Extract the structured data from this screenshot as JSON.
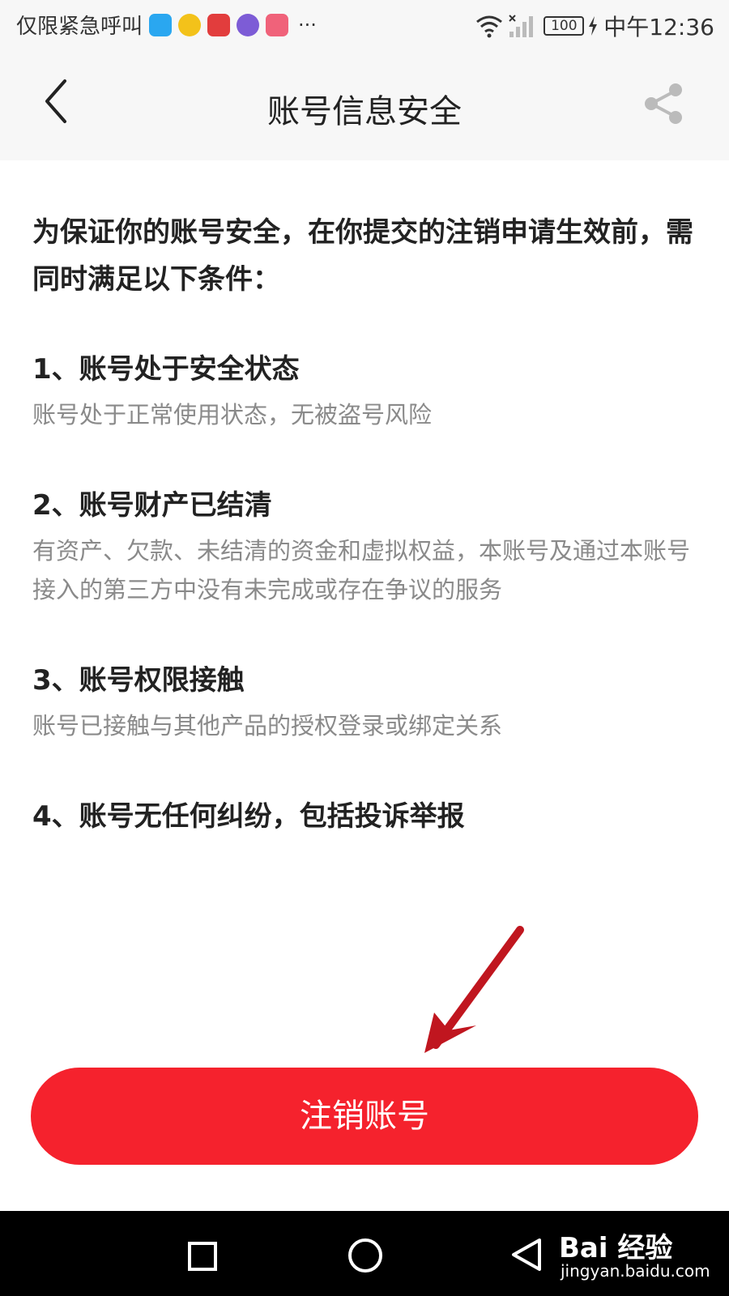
{
  "status_bar": {
    "carrier_text": "仅限紧急呼叫",
    "app_icon_colors": [
      "#2aa7f0",
      "#f3c21a",
      "#e23d3d",
      "#7d5cd6",
      "#f0627a"
    ],
    "dots": "···",
    "battery": "100",
    "time": "中午12:36"
  },
  "header": {
    "title": "账号信息安全"
  },
  "intro": "为保证你的账号安全，在你提交的注销申请生效前，需同时满足以下条件：",
  "conditions": [
    {
      "title": "1、账号处于安全状态",
      "desc": "账号处于正常使用状态，无被盗号风险"
    },
    {
      "title": "2、账号财产已结清",
      "desc": "有资产、欠款、未结清的资金和虚拟权益，本账号及通过本账号接入的第三方中没有未完成或存在争议的服务"
    },
    {
      "title": "3、账号权限接触",
      "desc": "账号已接触与其他产品的授权登录或绑定关系"
    },
    {
      "title": "4、账号无任何纠纷，包括投诉举报",
      "desc": ""
    }
  ],
  "button": {
    "label": "注销账号"
  },
  "watermark": {
    "brand": "Bai 经验",
    "url": "jingyan.baidu.com"
  },
  "colors": {
    "accent": "#f5222d",
    "arrow": "#c0161f"
  }
}
